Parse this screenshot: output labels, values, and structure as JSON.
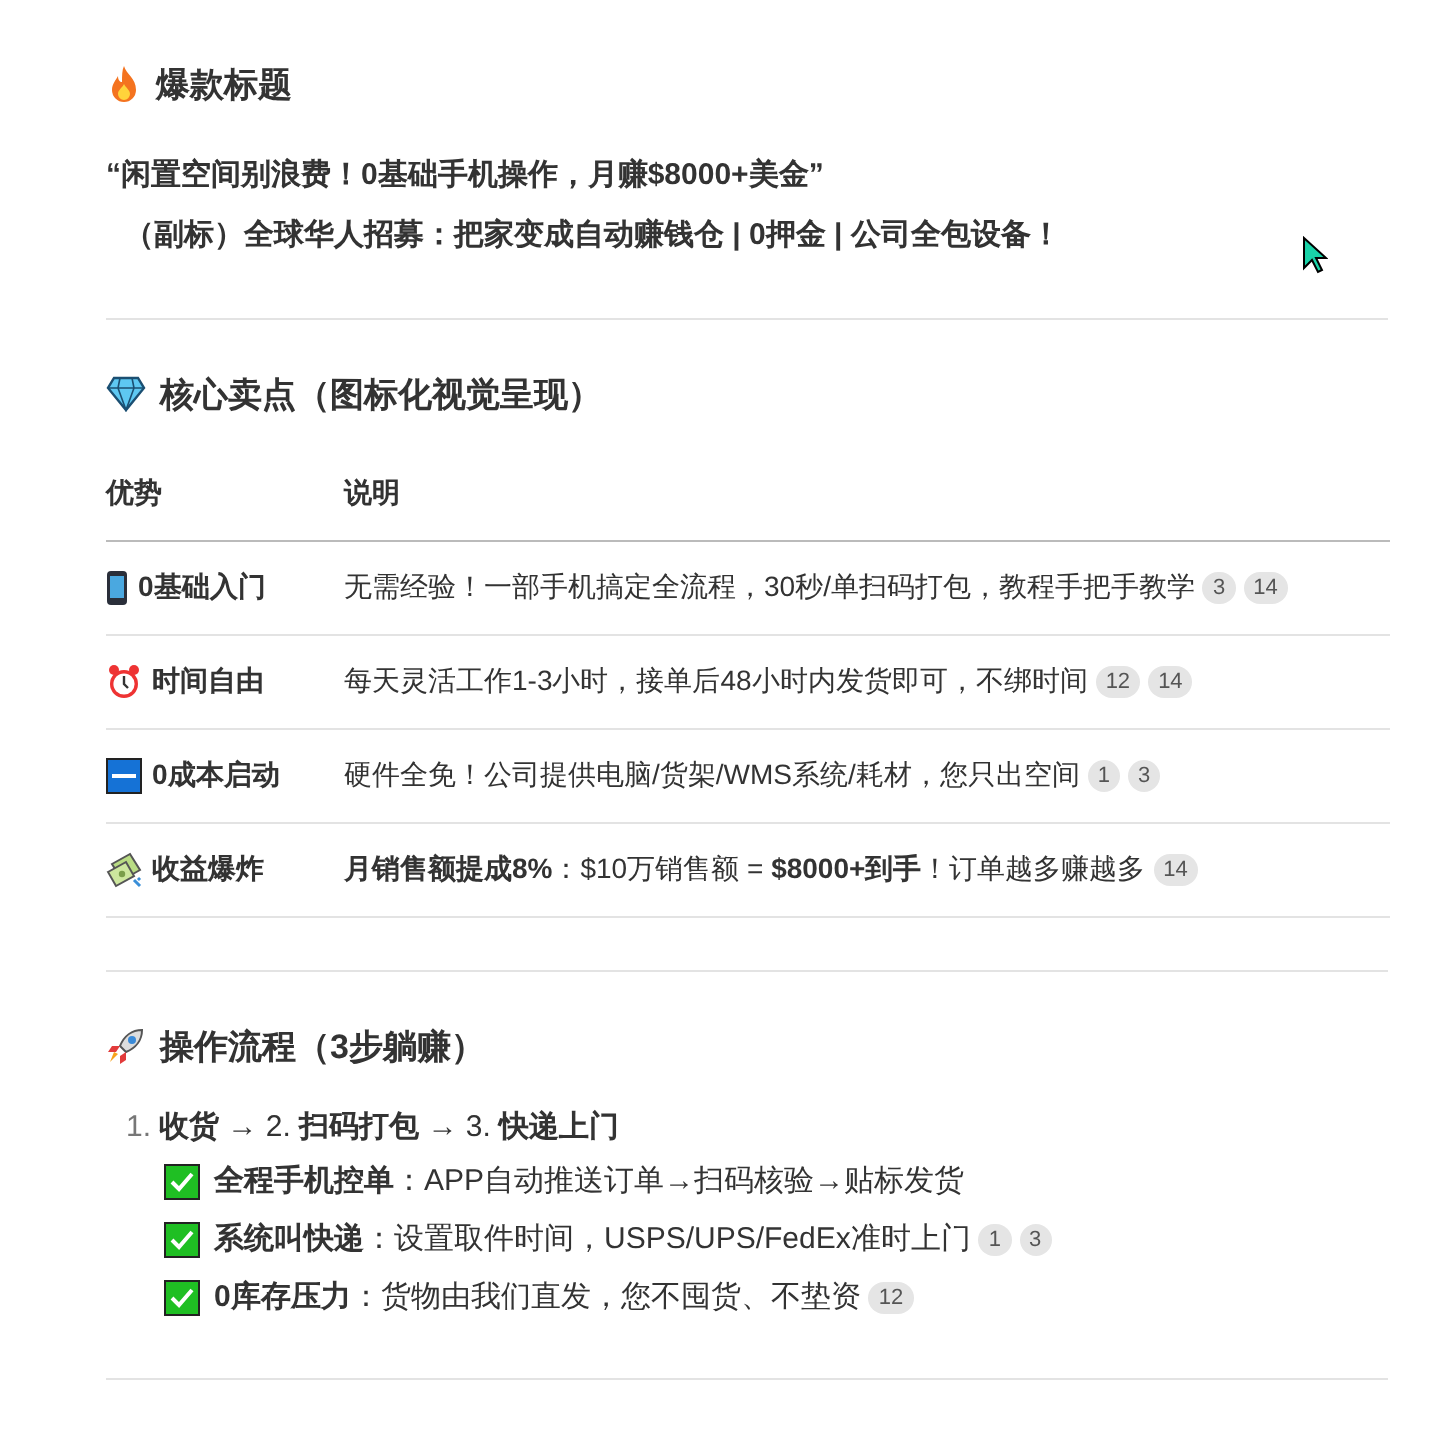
{
  "sections": [
    {
      "heading": "爆款标题",
      "kind": "titles",
      "lines": [
        "“闲置空间别浪费！0基础手机操作，月赚$8000+美金”",
        "（副标）全球华人招募：把家变成自动赚钱仓 | 0押金 | 公司全包设备！"
      ]
    },
    {
      "heading": "核心卖点（图标化视觉呈现）",
      "kind": "table",
      "columns": [
        "优势",
        "说明"
      ],
      "rows": [
        {
          "advantage": "0基础入门",
          "description": "无需经验！一部手机搞定全流程，30秒/单扫码打包，教程手把手教学",
          "refs": [
            "3",
            "14"
          ]
        },
        {
          "advantage": "时间自由",
          "description": "每天灵活工作1-3小时，接单后48小时内发货即可，不绑时间",
          "refs": [
            "12",
            "14"
          ]
        },
        {
          "advantage": "0成本启动",
          "description": "硬件全免！公司提供电脑/货架/WMS系统/耗材，您只出空间",
          "refs": [
            "1",
            "3"
          ]
        },
        {
          "advantage": "收益爆炸",
          "description": "**月销售额提成8%**：$10万销售额 = **$8000+到手**！订单越多赚越多",
          "refs": [
            "14"
          ]
        }
      ]
    },
    {
      "heading": "操作流程（3步躺赚）",
      "kind": "steps",
      "marker": "1.",
      "flow": "**收货** → 2. **扫码打包** → 3. **快递上门**",
      "items": [
        {
          "text": "**全程手机控单**：APP自动推送订单→扫码核验→贴标发货"
        },
        {
          "text": "**系统叫快递**：设置取件时间，USPS/UPS/FedEx准时上门",
          "refs": [
            "1",
            "3"
          ]
        },
        {
          "text": "**0库存压力**：货物由我们直发，您不囤货、不垫资",
          "refs": [
            "12"
          ]
        }
      ]
    }
  ]
}
